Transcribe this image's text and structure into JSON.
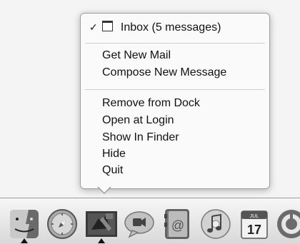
{
  "context_menu": {
    "window_item": {
      "check": "✓",
      "label": "Inbox (5 messages)"
    },
    "items_group_1": [
      {
        "label": "Get New Mail"
      },
      {
        "label": "Compose New Message"
      }
    ],
    "items_group_2": [
      {
        "label": "Remove from Dock"
      },
      {
        "label": "Open at Login"
      },
      {
        "label": "Show In Finder"
      },
      {
        "label": "Hide"
      },
      {
        "label": "Quit"
      }
    ]
  },
  "dock": {
    "apps": [
      {
        "name": "finder-icon"
      },
      {
        "name": "safari-icon"
      },
      {
        "name": "mail-icon"
      },
      {
        "name": "ichat-icon"
      },
      {
        "name": "address-book-icon"
      },
      {
        "name": "itunes-icon"
      },
      {
        "name": "ical-icon",
        "calendar_day": "17",
        "calendar_month": "JUL"
      },
      {
        "name": "system-preferences-icon"
      }
    ],
    "running_indicators": [
      "finder",
      "mail"
    ]
  }
}
